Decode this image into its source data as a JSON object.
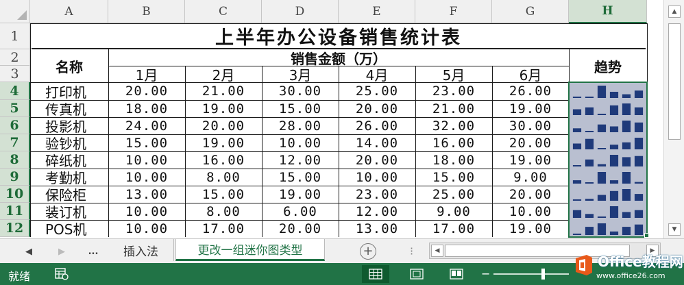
{
  "columns": [
    "A",
    "B",
    "C",
    "D",
    "E",
    "F",
    "G",
    "H"
  ],
  "selected_column": "H",
  "selected_rows": [
    4,
    5,
    6,
    7,
    8,
    9,
    10,
    11,
    12
  ],
  "row_numbers": [
    "1",
    "2",
    "3",
    "4",
    "5",
    "6",
    "7",
    "8",
    "9",
    "10",
    "11",
    "12"
  ],
  "table": {
    "title": "上半年办公设备销售统计表",
    "name_header": "名称",
    "sales_header": "销售金额（万）",
    "trend_header": "趋势",
    "months": [
      "1月",
      "2月",
      "3月",
      "4月",
      "5月",
      "6月"
    ],
    "rows": [
      {
        "name": "打印机",
        "values": [
          "20.00",
          "21.00",
          "30.00",
          "25.00",
          "23.00",
          "26.00"
        ]
      },
      {
        "name": "传真机",
        "values": [
          "18.00",
          "19.00",
          "15.00",
          "20.00",
          "21.00",
          "19.00"
        ]
      },
      {
        "name": "投影机",
        "values": [
          "24.00",
          "20.00",
          "28.00",
          "26.00",
          "32.00",
          "30.00"
        ]
      },
      {
        "name": "验钞机",
        "values": [
          "15.00",
          "19.00",
          "10.00",
          "14.00",
          "16.00",
          "20.00"
        ]
      },
      {
        "name": "碎纸机",
        "values": [
          "10.00",
          "16.00",
          "12.00",
          "20.00",
          "18.00",
          "19.00"
        ]
      },
      {
        "name": "考勤机",
        "values": [
          "10.00",
          "8.00",
          "15.00",
          "10.00",
          "15.00",
          "9.00"
        ]
      },
      {
        "name": "保险柜",
        "values": [
          "13.00",
          "15.00",
          "19.00",
          "23.00",
          "25.00",
          "20.00"
        ]
      },
      {
        "name": "装订机",
        "values": [
          "10.00",
          "8.00",
          "6.00",
          "12.00",
          "9.00",
          "10.00"
        ]
      },
      {
        "name": "POS机",
        "values": [
          "10.00",
          "17.00",
          "20.00",
          "13.00",
          "17.00",
          "19.00"
        ]
      }
    ]
  },
  "sheet_tabs": {
    "ellipsis": "...",
    "tabs": [
      "插入法",
      "更改一组迷你图类型"
    ],
    "active_index": 1
  },
  "status": {
    "ready": "就绪"
  },
  "watermark": {
    "title": "Office教程网",
    "url": "www.office26.com",
    "url_overlay": "https://www.excelcw.com"
  },
  "colors": {
    "excel_green": "#217346",
    "sparkline_bar": "#1f3a7a",
    "sparkline_bg": "#b9bfd0",
    "watermark_orange": "#e8591a"
  },
  "icons": [
    "tab-prev-icon",
    "tab-next-icon",
    "add-sheet-icon",
    "macro-record-icon",
    "normal-view-icon",
    "page-layout-view-icon",
    "page-break-view-icon",
    "office-logo-icon",
    "scroll-up-icon",
    "scroll-down-icon",
    "scroll-left-icon",
    "scroll-right-icon"
  ]
}
